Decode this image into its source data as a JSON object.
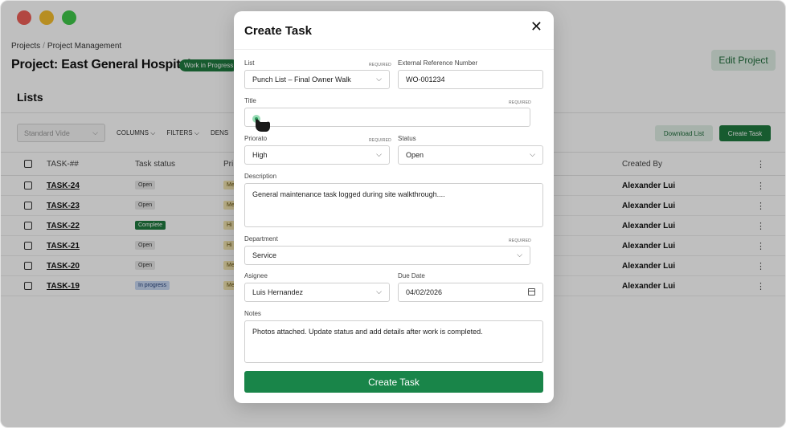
{
  "window": {
    "controls": [
      "close",
      "minimize",
      "maximize"
    ]
  },
  "breadcrumb": {
    "root": "Projects",
    "separator": "/",
    "current": "Project Management"
  },
  "project": {
    "title": "Project: East General Hospital",
    "status_badge": "Work in Progress",
    "edit_button": "Edit Project"
  },
  "lists": {
    "title": "Lists",
    "view_select": "Standard Vide",
    "toolbar": {
      "columns": "COLUMNS",
      "filters": "FILTERS",
      "density": "DENS"
    },
    "download_button": "Download List",
    "create_button": "Create Task"
  },
  "table": {
    "headers": {
      "id": "TASK-##",
      "status": "Task status",
      "priority": "Pri",
      "created_by": "Created By"
    },
    "rows": [
      {
        "id": "TASK-24",
        "status": "Open",
        "status_kind": "open",
        "priority": "Me",
        "created_by": "Alexander Lui"
      },
      {
        "id": "TASK-23",
        "status": "Open",
        "status_kind": "open",
        "priority": "Me",
        "created_by": "Alexander Lui"
      },
      {
        "id": "TASK-22",
        "status": "Complete",
        "status_kind": "complete",
        "priority": "Hi",
        "created_by": "Alexander Lui"
      },
      {
        "id": "TASK-21",
        "status": "Open",
        "status_kind": "open",
        "priority": "Hi",
        "created_by": "Alexander Lui"
      },
      {
        "id": "TASK-20",
        "status": "Open",
        "status_kind": "open",
        "priority": "Me",
        "created_by": "Alexander Lui"
      },
      {
        "id": "TASK-19",
        "status": "In progress",
        "status_kind": "progress",
        "priority": "Me",
        "created_by": "Alexander Lui"
      }
    ]
  },
  "modal": {
    "title": "Create Task",
    "list": {
      "label": "List",
      "required": "REQUIRED",
      "value": "Punch List – Final Owner Walk"
    },
    "external_ref": {
      "label": "External Reference Number",
      "value": "WO-001234"
    },
    "title_field": {
      "label": "Title",
      "required": "REQUIRED",
      "value": ""
    },
    "priority": {
      "label": "Priorato",
      "required": "REQUIRED",
      "value": "High"
    },
    "status": {
      "label": "Status",
      "value": "Open"
    },
    "description": {
      "label": "Description",
      "value": "General maintenance task logged during site walkthrough...."
    },
    "department": {
      "label": "Department",
      "required": "REQUIRED",
      "value": "Service"
    },
    "assignee": {
      "label": "Asignee",
      "value": "Luis Hernandez"
    },
    "due_date": {
      "label": "Due Date",
      "value": "04/02/2026"
    },
    "notes": {
      "label": "Notes",
      "value": "Photos attached. Update status and add details after work is completed."
    },
    "submit": "Create Task"
  },
  "colors": {
    "primary": "#198549",
    "badge_green": "#1f7a3f",
    "light_green": "#dfeee5",
    "overlay": "rgba(0,0,0,0.25)"
  },
  "icons": {
    "close": "close-icon",
    "chevron": "chevron-down-icon",
    "calendar": "calendar-icon",
    "cursor": "hand-pointer-icon",
    "row_menu": "kebab-menu-icon"
  }
}
